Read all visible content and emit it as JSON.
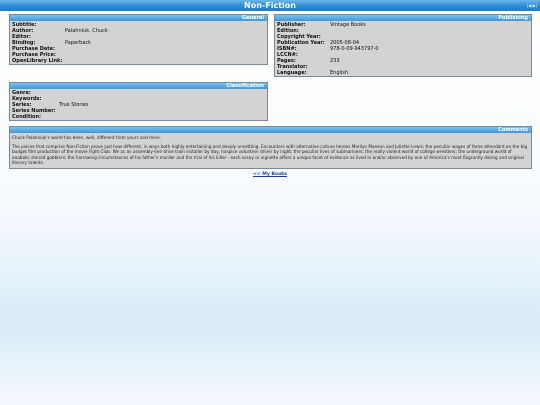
{
  "title": "Non-Fiction",
  "nav": [
    "|◀",
    "▶|"
  ],
  "general": {
    "header": "General",
    "rows": [
      {
        "label": "Subtitle:",
        "value": ""
      },
      {
        "label": "Author:",
        "value": "Palahniuk, Chuck"
      },
      {
        "label": "Editor:",
        "value": ""
      },
      {
        "label": "Binding:",
        "value": "Paperback"
      },
      {
        "label": "Purchase Date:",
        "value": ""
      },
      {
        "label": "Purchase Price:",
        "value": ""
      },
      {
        "label": "OpenLibrary Link:",
        "value": ""
      }
    ]
  },
  "publishing": {
    "header": "Publishing",
    "rows": [
      {
        "label": "Publisher:",
        "value": "Vintage Books"
      },
      {
        "label": "Edition:",
        "value": ""
      },
      {
        "label": "Copyright Year:",
        "value": ""
      },
      {
        "label": "Publication Year:",
        "value": "2005-08-04"
      },
      {
        "label": "ISBN#:",
        "value": "978-0-09-943797-0"
      },
      {
        "label": "LCCN#:",
        "value": ""
      },
      {
        "label": "Pages:",
        "value": "233"
      },
      {
        "label": "Translator:",
        "value": ""
      },
      {
        "label": "Language:",
        "value": "English"
      }
    ]
  },
  "classification": {
    "header": "Classification",
    "rows": [
      {
        "label": "Genre:",
        "value": ""
      },
      {
        "label": "Keywords:",
        "value": ""
      },
      {
        "label": "Series:",
        "value": "True Stories"
      },
      {
        "label": "Series Number:",
        "value": ""
      },
      {
        "label": "Condition:",
        "value": ""
      }
    ]
  },
  "comments": {
    "header": "Comments",
    "paragraphs": [
      "Chuck Palahniuk's world has been, well, different from yours and mine.",
      "The pieces that comprise Non-Fiction prove just how different, in ways both highly entertaining and deeply unsettling. Encounters with alternative culture heroes Marilyn Manson and Juliette Lewis; the peculiar wages of fame attendant on the big budget film production of the movie Fight Club. We as an assembly-line drive train installer by day, hospice volunteer driver by night; the peculiar lives of submariners; the really violent world of college wrestlers; the underground world of anabolic steroid gobblers; the harrowing circumstances of his father's murder and the trial of his killer - each essay or vignette offers a unique facet of evidence as lived in and/or observed by one of America's most flagrantly daring and original literary talents."
    ]
  },
  "back_link": "<< My Books"
}
